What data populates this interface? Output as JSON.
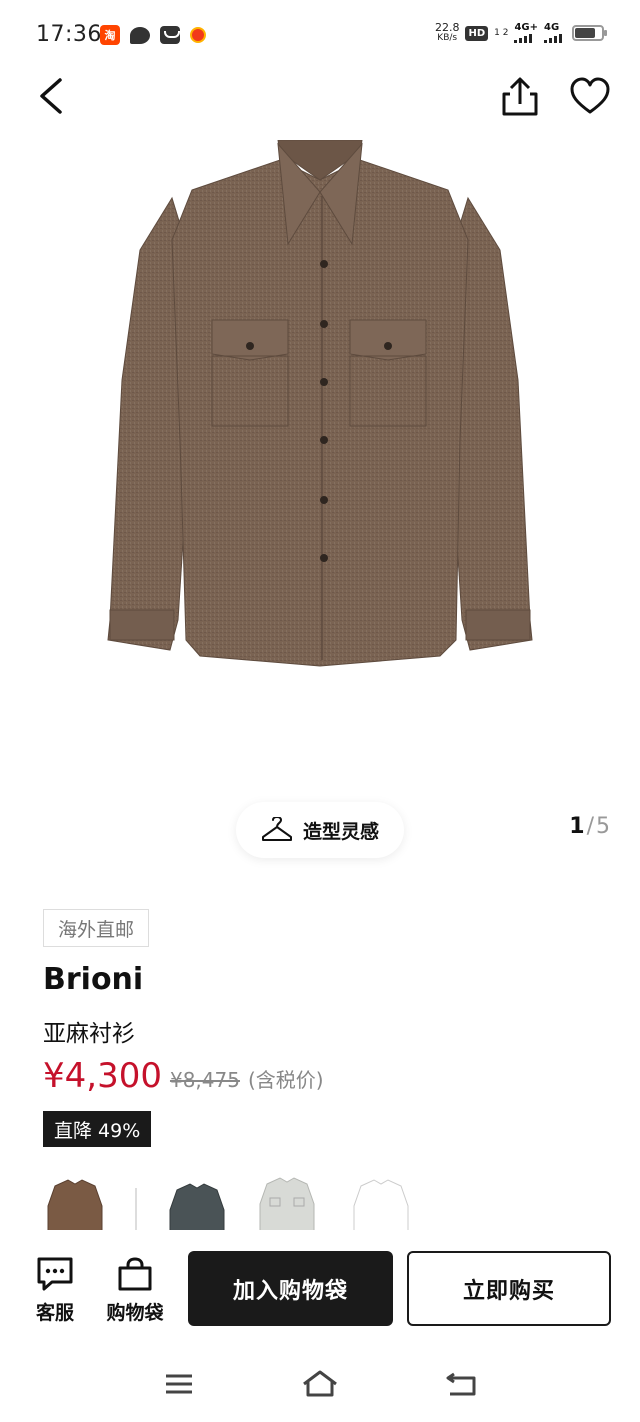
{
  "status_bar": {
    "time": "17:36",
    "taobao_label": "淘",
    "net_speed_value": "22.8",
    "net_speed_unit": "KB/s",
    "hd_label": "HD",
    "sim_slots": "1 2",
    "signal_1_label": "4G+",
    "signal_2_label": "4G"
  },
  "product": {
    "image_icon": "shirt-image",
    "shirt_color": "#7a6352",
    "styling_label": "造型灵感",
    "pager": {
      "current": "1",
      "separator": "/",
      "total": "5"
    },
    "tag": "海外直邮",
    "brand": "Brioni",
    "name": "亚麻衬衫",
    "price": "¥4,300",
    "original_price": "¥8,475",
    "tax_note": "(含税价)",
    "discount": "直降 49%",
    "accent_color": "#c5112b"
  },
  "variants": [
    {
      "name": "brown",
      "color": "#7a5a44"
    },
    {
      "name": "slate",
      "color": "#4a5356"
    },
    {
      "name": "light-grey",
      "color": "#d8dad6"
    },
    {
      "name": "white",
      "color": "#ffffff"
    }
  ],
  "actions": {
    "service_label": "客服",
    "bag_label": "购物袋",
    "add_to_bag": "加入购物袋",
    "buy_now": "立即购买"
  }
}
